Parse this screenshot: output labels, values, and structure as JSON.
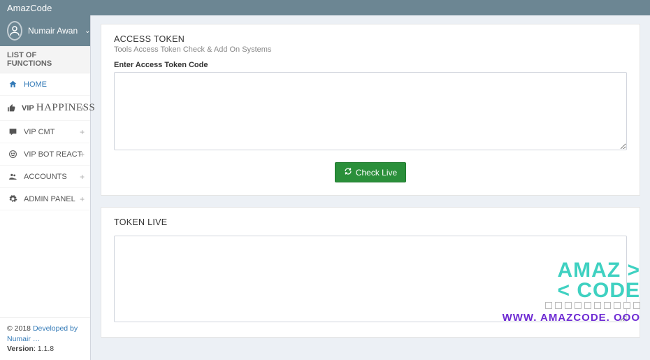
{
  "header": {
    "brand": "AmazCode"
  },
  "user": {
    "name": "Numair Awan"
  },
  "sidebar": {
    "list_header": "LIST OF FUNCTIONS",
    "items": [
      {
        "label": "HOME",
        "expandable": false
      },
      {
        "label_a": "VIP",
        "label_b": "HAPPINESS",
        "expandable": true
      },
      {
        "label": "VIP CMT",
        "expandable": true
      },
      {
        "label": "VIP BOT REACT",
        "expandable": true
      },
      {
        "label": "ACCOUNTS",
        "expandable": true
      },
      {
        "label": "ADMIN PANEL",
        "expandable": true
      }
    ]
  },
  "panel1": {
    "title": "ACCESS TOKEN",
    "subtitle": "Tools Access Token Check & Add On Systems",
    "field_label": "Enter Access Token Code",
    "button": "Check Live"
  },
  "panel2": {
    "title": "TOKEN LIVE"
  },
  "footer": {
    "copyright_prefix": "© 2018 ",
    "copyright_link": "Developed by Numair …",
    "version_label": "Version",
    "version": "1.1.8"
  },
  "watermark": {
    "line1": "AMAZ >",
    "line2": "< CODE",
    "line3": "WWW. AMAZCODE. OOO"
  }
}
